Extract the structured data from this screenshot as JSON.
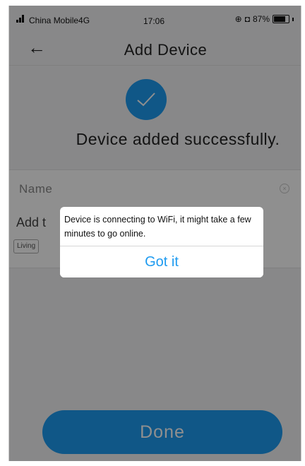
{
  "status_bar": {
    "carrier": "China Mobile4G",
    "time": "17:06",
    "battery": "87%",
    "battery_level": 0.87
  },
  "header": {
    "title": "Add Device",
    "back_icon": "arrow-left-icon"
  },
  "success": {
    "icon": "checkmark-icon",
    "message": "Device added successfully.",
    "accent_color": "#1e9bf0"
  },
  "form": {
    "name_label": "Name",
    "room_label": "Add t",
    "room_chip": "Living"
  },
  "done_button": {
    "label": "Done"
  },
  "dialog": {
    "message": "Device is connecting to WiFi, it might take a few minutes to go online.",
    "button_label": "Got it"
  }
}
